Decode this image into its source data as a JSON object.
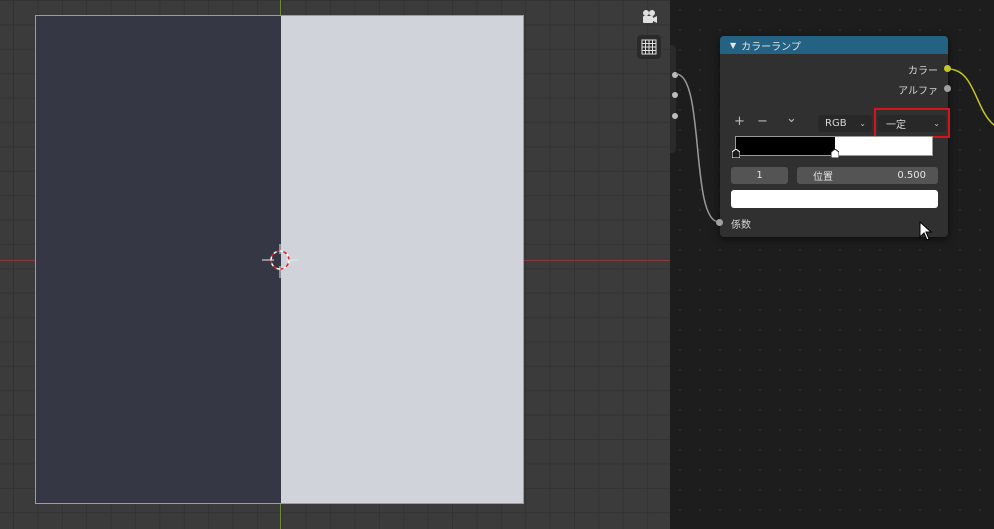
{
  "viewport": {
    "icons": [
      "camera-view-icon",
      "grid-view-icon"
    ]
  },
  "node": {
    "title": "カラーランプ",
    "header_color": "#246283",
    "outputs": [
      {
        "label": "カラー",
        "socket_color": "#c7c729"
      },
      {
        "label": "アルファ",
        "socket_color": "#a1a1a1"
      }
    ],
    "controls": {
      "add_icon": "+",
      "remove_icon": "−",
      "menu_icon": "⌄"
    },
    "color_mode": {
      "value": "RGB"
    },
    "interpolation": {
      "value": "一定",
      "highlight_color": "#d3151c"
    },
    "ramp": {
      "stops": [
        {
          "position": 0.0,
          "color": "#000000"
        },
        {
          "position": 0.5,
          "color": "#ffffff"
        }
      ]
    },
    "active_stop_index": "1",
    "position_label": "位置",
    "position_value": "0.500",
    "stop_color": "#ffffff",
    "input": {
      "label": "係数"
    }
  }
}
